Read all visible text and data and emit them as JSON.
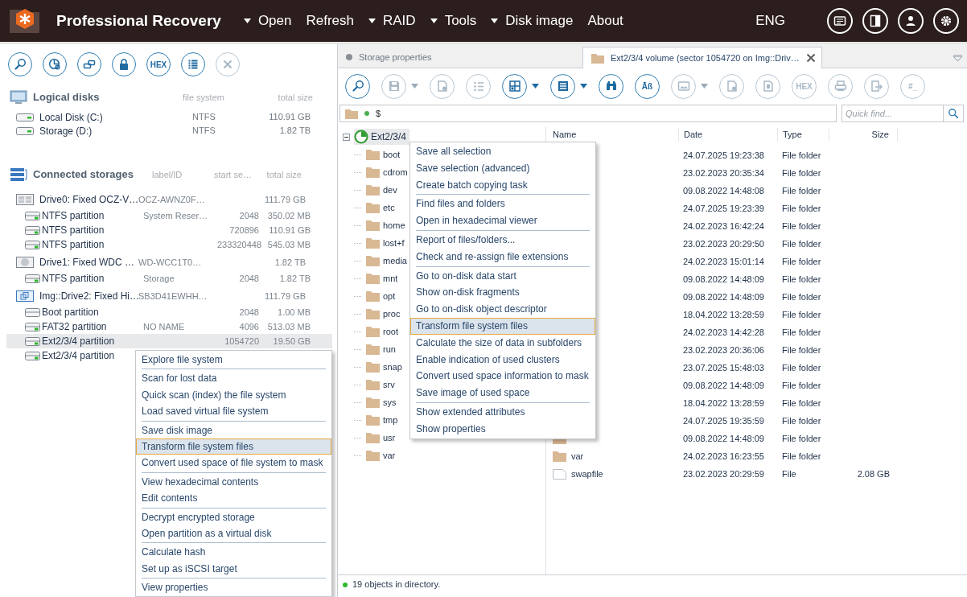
{
  "app": {
    "title": "Professional Recovery",
    "language": "ENG",
    "menu": [
      {
        "label": "Open",
        "dropdown": true
      },
      {
        "label": "Refresh",
        "dropdown": false
      },
      {
        "label": "RAID",
        "dropdown": true
      },
      {
        "label": "Tools",
        "dropdown": true
      },
      {
        "label": "Disk image",
        "dropdown": true
      },
      {
        "label": "About",
        "dropdown": false
      }
    ],
    "header_buttons": [
      {
        "disabled": false
      },
      {
        "disabled": false
      },
      {
        "disabled": false
      },
      {
        "disabled": false
      }
    ]
  },
  "left_toolbar": [
    {
      "disabled": false
    },
    {
      "disabled": false
    },
    {
      "disabled": false
    },
    {
      "disabled": false
    },
    {
      "label": "HEX",
      "disabled": false
    },
    {
      "disabled": false
    },
    {
      "disabled": true
    }
  ],
  "logical_disks": {
    "title": "Logical disks",
    "columns": [
      "file system",
      "total size"
    ],
    "rows": [
      {
        "name": "Local Disk (C:)",
        "file_system": "NTFS",
        "size": "110.91 GB"
      },
      {
        "name": "Storage (D:)",
        "file_system": "NTFS",
        "size": "1.82 TB"
      }
    ]
  },
  "connected_storages": {
    "title": "Connected storages",
    "columns": [
      "label/ID",
      "start se…",
      "total size"
    ],
    "rows": [
      {
        "kind": "drive",
        "name": "Drive0: Fixed OCZ-V…",
        "label": "OCZ-AWNZ0F…",
        "size": "111.79 GB",
        "selected": false
      },
      {
        "kind": "partition",
        "name": "NTFS partition",
        "label": "System Reser…",
        "start": "2048",
        "size": "350.02 MB",
        "selected": false
      },
      {
        "kind": "partition",
        "name": "NTFS partition",
        "start": "720896",
        "size": "110.91 GB",
        "selected": false
      },
      {
        "kind": "partition",
        "name": "NTFS partition",
        "start": "233320448",
        "size": "545.03 MB",
        "selected": false
      },
      {
        "kind": "disk",
        "name": "Drive1: Fixed WDC …",
        "label": "WD-WCC1T0…",
        "size": "1.82 TB",
        "selected": false
      },
      {
        "kind": "partition",
        "name": "NTFS partition",
        "label": "Storage",
        "start": "2048",
        "size": "1.82 TB",
        "selected": false
      },
      {
        "kind": "image",
        "name": "Img::Drive2: Fixed Hi…",
        "label": "SB3D41EWHH…",
        "size": "111.79 GB",
        "selected": false
      },
      {
        "kind": "unknown_partition",
        "name": "Boot partition",
        "start": "2048",
        "size": "1.00 MB",
        "selected": false
      },
      {
        "kind": "partition",
        "name": "FAT32 partition",
        "label": "NO NAME",
        "start": "4096",
        "size": "513.03 MB",
        "selected": false
      },
      {
        "kind": "partition",
        "name": "Ext2/3/4 partition",
        "start": "1054720",
        "size": "19.50 GB",
        "selected": true
      },
      {
        "kind": "partition",
        "name": "Ext2/3/4 partition",
        "selected": false
      }
    ]
  },
  "storage_menu": [
    {
      "kind": "item",
      "label": "Explore file system",
      "highlighted": false
    },
    {
      "kind": "separator"
    },
    {
      "kind": "item",
      "label": "Scan for lost data",
      "highlighted": false
    },
    {
      "kind": "item",
      "label": "Quick scan (index) the file system",
      "highlighted": false
    },
    {
      "kind": "item",
      "label": "Load saved virtual file system",
      "highlighted": false
    },
    {
      "kind": "separator"
    },
    {
      "kind": "item",
      "label": "Save disk image",
      "highlighted": false
    },
    {
      "kind": "item",
      "label": "Transform file system files",
      "highlighted": true
    },
    {
      "kind": "item",
      "label": "Convert used space of file system to mask",
      "highlighted": false
    },
    {
      "kind": "separator"
    },
    {
      "kind": "item",
      "label": "View hexadecimal contents",
      "highlighted": false
    },
    {
      "kind": "item",
      "label": "Edit contents",
      "highlighted": false
    },
    {
      "kind": "separator"
    },
    {
      "kind": "item",
      "label": "Decrypt encrypted storage",
      "highlighted": false
    },
    {
      "kind": "item",
      "label": "Open partition as a virtual disk",
      "highlighted": false
    },
    {
      "kind": "separator"
    },
    {
      "kind": "item",
      "label": "Calculate hash",
      "highlighted": false
    },
    {
      "kind": "item",
      "label": "Set up as iSCSI target",
      "highlighted": false
    },
    {
      "kind": "separator"
    },
    {
      "kind": "item",
      "label": "View properties",
      "highlighted": false
    }
  ],
  "tabs": [
    {
      "label": "Storage properties",
      "selected": false
    },
    {
      "label": "Ext2/3/4 volume (sector 1054720 on Img::Driv…",
      "selected": true
    }
  ],
  "right_toolbar": [
    {
      "disabled": false,
      "dropdown": false
    },
    {
      "disabled": true,
      "dropdown": true
    },
    {
      "disabled": true,
      "dropdown": false
    },
    {
      "disabled": true,
      "dropdown": false
    },
    {
      "disabled": false,
      "dropdown": true
    },
    {
      "disabled": false,
      "dropdown": true
    },
    {
      "disabled": false,
      "dropdown": false
    },
    {
      "label": "Āß",
      "disabled": false,
      "dropdown": false
    },
    {
      "disabled": true,
      "dropdown": true
    },
    {
      "disabled": true,
      "dropdown": false
    },
    {
      "disabled": true,
      "dropdown": false
    },
    {
      "label": "HEX",
      "disabled": true,
      "dropdown": false
    },
    {
      "disabled": true,
      "dropdown": false
    },
    {
      "disabled": true,
      "dropdown": false
    },
    {
      "label": "#_",
      "disabled": true,
      "dropdown": false
    }
  ],
  "path": {
    "value": "$"
  },
  "quick_find": {
    "placeholder": "Quick find..."
  },
  "tree": {
    "label": "Ext2/3/4",
    "expanded": true,
    "selected": true,
    "children": [
      {
        "label": "boot"
      },
      {
        "label": "cdrom"
      },
      {
        "label": "dev"
      },
      {
        "label": "etc"
      },
      {
        "label": "home"
      },
      {
        "label": "lost+f"
      },
      {
        "label": "media"
      },
      {
        "label": "mnt"
      },
      {
        "label": "opt"
      },
      {
        "label": "proc"
      },
      {
        "label": "root"
      },
      {
        "label": "run"
      },
      {
        "label": "snap"
      },
      {
        "label": "srv"
      },
      {
        "label": "sys"
      },
      {
        "label": "tmp"
      },
      {
        "label": "usr"
      },
      {
        "label": "var"
      }
    ]
  },
  "file_list": {
    "columns": [
      "Name",
      "Date",
      "Type",
      "Size"
    ],
    "rows": [
      {
        "date": "24.07.2025 19:23:38",
        "type": "File folder"
      },
      {
        "date": "23.02.2023 20:35:34",
        "type": "File folder"
      },
      {
        "date": "09.08.2022 14:48:08",
        "type": "File folder"
      },
      {
        "date": "24.07.2025 19:23:39",
        "type": "File folder"
      },
      {
        "date": "24.02.2023 16:42:24",
        "type": "File folder"
      },
      {
        "date": "23.02.2023 20:29:50",
        "type": "File folder"
      },
      {
        "date": "24.02.2023 15:01:14",
        "type": "File folder"
      },
      {
        "date": "09.08.2022 14:48:09",
        "type": "File folder"
      },
      {
        "date": "09.08.2022 14:48:09",
        "type": "File folder"
      },
      {
        "date": "18.04.2022 13:28:59",
        "type": "File folder"
      },
      {
        "date": "24.02.2023 14:42:28",
        "type": "File folder"
      },
      {
        "date": "23.02.2023 20:36:06",
        "type": "File folder"
      },
      {
        "date": "23.07.2025 15:48:03",
        "type": "File folder"
      },
      {
        "date": "09.08.2022 14:48:09",
        "type": "File folder"
      },
      {
        "date": "18.04.2022 13:28:59",
        "type": "File folder"
      },
      {
        "date": "24.07.2025 19:35:59",
        "type": "File folder"
      },
      {
        "kind": "folder",
        "date": "09.08.2022 14:48:09",
        "type": "File folder"
      },
      {
        "kind": "folder",
        "name": "var",
        "date": "24.02.2023 16:23:55",
        "type": "File folder"
      },
      {
        "kind": "file",
        "name": "swapfile",
        "date": "23.02.2023 20:29:59",
        "type": "File",
        "size": "2.08 GB"
      }
    ]
  },
  "folder_menu": [
    {
      "kind": "item",
      "label": "Save all selection",
      "highlighted": false
    },
    {
      "kind": "item",
      "label": "Save selection (advanced)",
      "highlighted": false
    },
    {
      "kind": "item",
      "label": "Create batch copying task",
      "highlighted": false
    },
    {
      "kind": "separator"
    },
    {
      "kind": "item",
      "label": "Find files and folders",
      "highlighted": false
    },
    {
      "kind": "item",
      "label": "Open in hexadecimal viewer",
      "highlighted": false
    },
    {
      "kind": "separator"
    },
    {
      "kind": "item",
      "label": "Report of files/folders...",
      "highlighted": false
    },
    {
      "kind": "item",
      "label": "Check and re-assign file extensions",
      "highlighted": false
    },
    {
      "kind": "separator"
    },
    {
      "kind": "item",
      "label": "Go to on-disk data start",
      "highlighted": false
    },
    {
      "kind": "item",
      "label": "Show on-disk fragments",
      "highlighted": false
    },
    {
      "kind": "item",
      "label": "Go to on-disk object descriptor",
      "highlighted": false
    },
    {
      "kind": "item",
      "label": "Transform file system files",
      "highlighted": true
    },
    {
      "kind": "item",
      "label": "Calculate the size of data in subfolders",
      "highlighted": false
    },
    {
      "kind": "item",
      "label": "Enable indication of used clusters",
      "highlighted": false
    },
    {
      "kind": "item",
      "label": "Convert used space information to mask",
      "highlighted": false
    },
    {
      "kind": "item",
      "label": "Save image of used space",
      "highlighted": false
    },
    {
      "kind": "separator"
    },
    {
      "kind": "item",
      "label": "Show extended attributes",
      "highlighted": false
    },
    {
      "kind": "item",
      "label": "Show properties",
      "highlighted": false
    }
  ],
  "status_bar": {
    "text": "19 objects in directory."
  }
}
